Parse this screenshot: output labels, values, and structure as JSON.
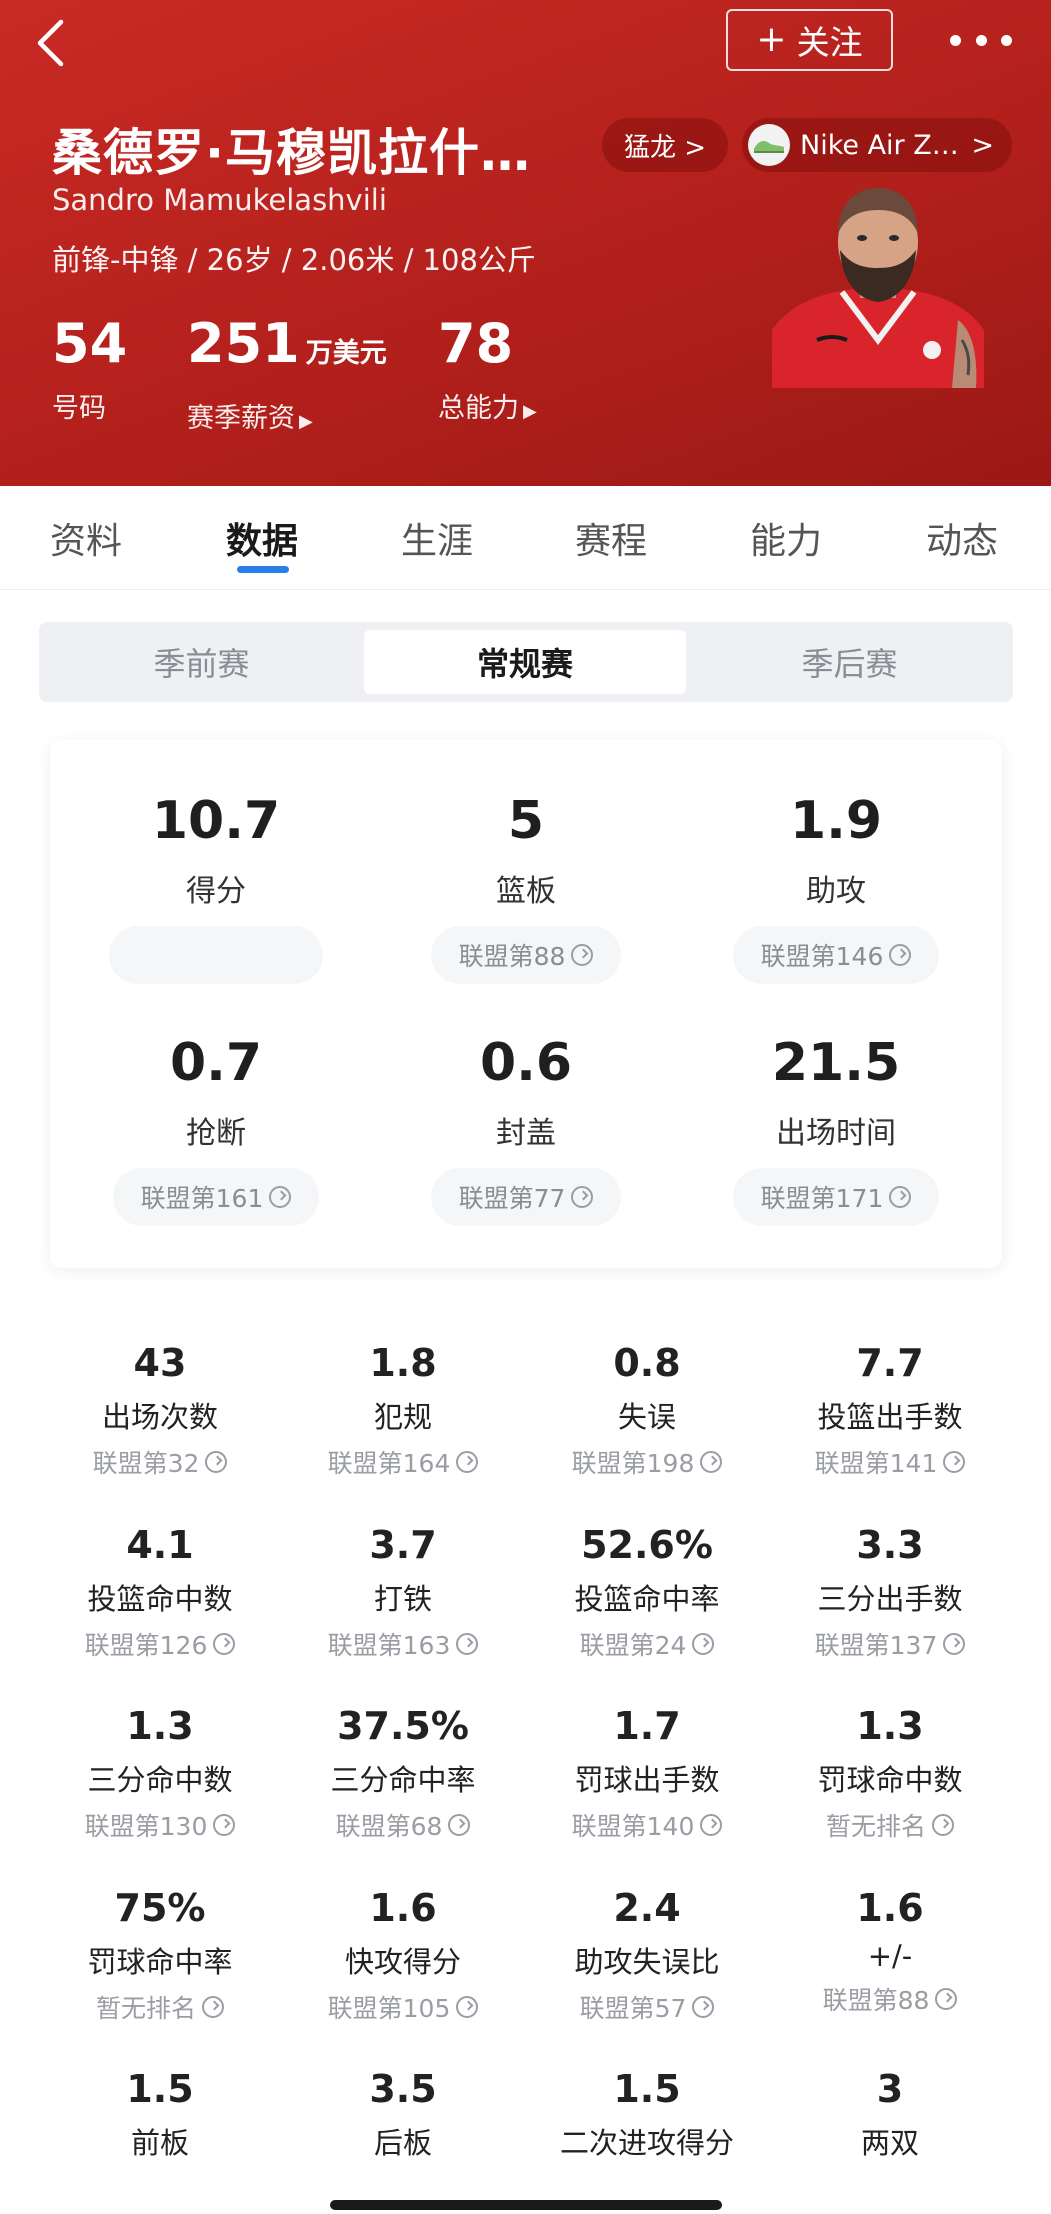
{
  "header": {
    "follow_label": "关注",
    "name_cn": "桑德罗·马穆凯拉什…",
    "name_en": "Sandro Mamukelashvili",
    "meta": "前锋-中锋 / 26岁 / 2.06米 / 108公斤",
    "team_pill": "猛龙 >",
    "shoe_pill": "Nike Air Z…",
    "shoe_arrow": ">",
    "stats": [
      {
        "value": "54",
        "unit": "",
        "label": "号码"
      },
      {
        "value": "251",
        "unit": "万美元",
        "label": "赛季薪资"
      },
      {
        "value": "78",
        "unit": "",
        "label": "总能力"
      }
    ],
    "colors": {
      "primary": "#b3201c",
      "accent": "#2a7fe6"
    }
  },
  "tabs": [
    "资料",
    "数据",
    "生涯",
    "赛程",
    "能力",
    "动态"
  ],
  "active_tab": "数据",
  "segments": [
    "季前赛",
    "常规赛",
    "季后赛"
  ],
  "active_segment": "常规赛",
  "main_card": [
    {
      "value": "10.7",
      "label": "得分",
      "rank": ""
    },
    {
      "value": "5",
      "label": "篮板",
      "rank": "联盟第88"
    },
    {
      "value": "1.9",
      "label": "助攻",
      "rank": "联盟第146"
    },
    {
      "value": "0.7",
      "label": "抢断",
      "rank": "联盟第161"
    },
    {
      "value": "0.6",
      "label": "封盖",
      "rank": "联盟第77"
    },
    {
      "value": "21.5",
      "label": "出场时间",
      "rank": "联盟第171"
    }
  ],
  "grid": [
    {
      "value": "43",
      "label": "出场次数",
      "rank": "联盟第32"
    },
    {
      "value": "1.8",
      "label": "犯规",
      "rank": "联盟第164"
    },
    {
      "value": "0.8",
      "label": "失误",
      "rank": "联盟第198"
    },
    {
      "value": "7.7",
      "label": "投篮出手数",
      "rank": "联盟第141"
    },
    {
      "value": "4.1",
      "label": "投篮命中数",
      "rank": "联盟第126"
    },
    {
      "value": "3.7",
      "label": "打铁",
      "rank": "联盟第163"
    },
    {
      "value": "52.6%",
      "label": "投篮命中率",
      "rank": "联盟第24"
    },
    {
      "value": "3.3",
      "label": "三分出手数",
      "rank": "联盟第137"
    },
    {
      "value": "1.3",
      "label": "三分命中数",
      "rank": "联盟第130"
    },
    {
      "value": "37.5%",
      "label": "三分命中率",
      "rank": "联盟第68"
    },
    {
      "value": "1.7",
      "label": "罚球出手数",
      "rank": "联盟第140"
    },
    {
      "value": "1.3",
      "label": "罚球命中数",
      "rank": "暂无排名"
    },
    {
      "value": "75%",
      "label": "罚球命中率",
      "rank": "暂无排名"
    },
    {
      "value": "1.6",
      "label": "快攻得分",
      "rank": "联盟第105"
    },
    {
      "value": "2.4",
      "label": "助攻失误比",
      "rank": "联盟第57"
    },
    {
      "value": "1.6",
      "label": "+/-",
      "rank": "联盟第88"
    },
    {
      "value": "1.5",
      "label": "前板",
      "rank": ""
    },
    {
      "value": "3.5",
      "label": "后板",
      "rank": ""
    },
    {
      "value": "1.5",
      "label": "二次进攻得分",
      "rank": ""
    },
    {
      "value": "3",
      "label": "两双",
      "rank": ""
    }
  ]
}
